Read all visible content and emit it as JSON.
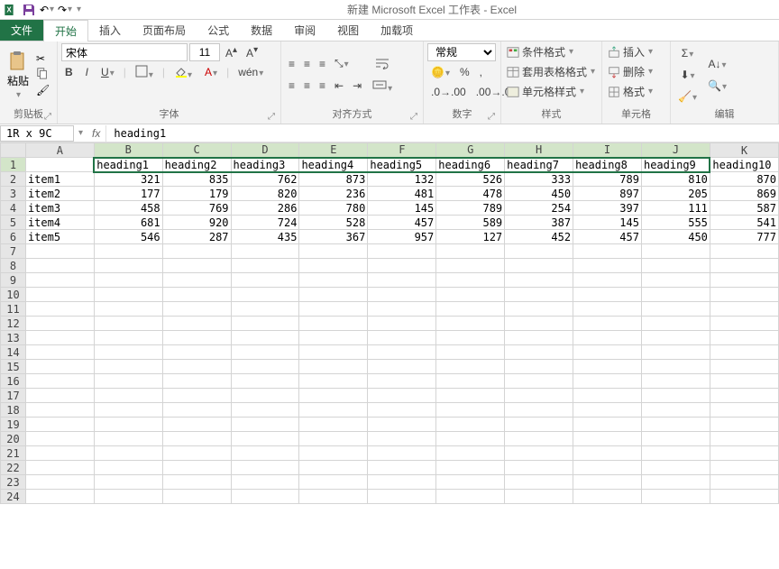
{
  "title": "新建 Microsoft Excel 工作表 - Excel",
  "tabs": {
    "file": "文件",
    "home": "开始",
    "insert": "插入",
    "layout": "页面布局",
    "formulas": "公式",
    "data": "数据",
    "review": "审阅",
    "view": "视图",
    "addins": "加载项"
  },
  "clipboard": {
    "paste": "粘贴",
    "label": "剪贴板"
  },
  "font": {
    "name": "宋体",
    "size": "11",
    "label": "字体"
  },
  "align": {
    "label": "对齐方式"
  },
  "number": {
    "format": "常规",
    "label": "数字"
  },
  "styles": {
    "cond": "条件格式",
    "table": "套用表格格式",
    "cell": "单元格样式",
    "label": "样式"
  },
  "cells": {
    "insert": "插入",
    "delete": "删除",
    "format": "格式",
    "label": "单元格"
  },
  "editing": {
    "label": "编辑"
  },
  "namebox": "1R x 9C",
  "formula": "heading1",
  "cols": [
    "A",
    "B",
    "C",
    "D",
    "E",
    "F",
    "G",
    "H",
    "I",
    "J",
    "K"
  ],
  "rows": 24,
  "headings": [
    "heading1",
    "heading2",
    "heading3",
    "heading4",
    "heading5",
    "heading6",
    "heading7",
    "heading8",
    "heading9",
    "heading10"
  ],
  "dataRows": [
    {
      "item": "item1",
      "v": [
        321,
        835,
        762,
        873,
        132,
        526,
        333,
        789,
        810,
        870
      ]
    },
    {
      "item": "item2",
      "v": [
        177,
        179,
        820,
        236,
        481,
        478,
        450,
        897,
        205,
        869
      ]
    },
    {
      "item": "item3",
      "v": [
        458,
        769,
        286,
        780,
        145,
        789,
        254,
        397,
        111,
        587
      ]
    },
    {
      "item": "item4",
      "v": [
        681,
        920,
        724,
        528,
        457,
        589,
        387,
        145,
        555,
        541
      ]
    },
    {
      "item": "item5",
      "v": [
        546,
        287,
        435,
        367,
        957,
        127,
        452,
        457,
        450,
        777
      ]
    }
  ]
}
